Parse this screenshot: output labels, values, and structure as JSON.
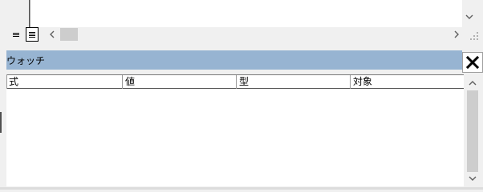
{
  "code_window": {
    "vscroll_down_icon": "chevron-down-icon",
    "hscroll_left_icon": "chevron-left-icon",
    "hscroll_right_icon": "chevron-right-icon",
    "procedure_view_icon": "procedure-view-icon",
    "full_module_view_icon": "full-module-view-icon"
  },
  "watch_window": {
    "title": "ウォッチ",
    "close_icon": "close-icon",
    "columns": [
      "式",
      "値",
      "型",
      "対象"
    ],
    "rows": [],
    "colors": {
      "titlebar": "#97b4d2",
      "list_background": "#ffffff",
      "scroll_thumb": "#cdcdcd"
    }
  }
}
